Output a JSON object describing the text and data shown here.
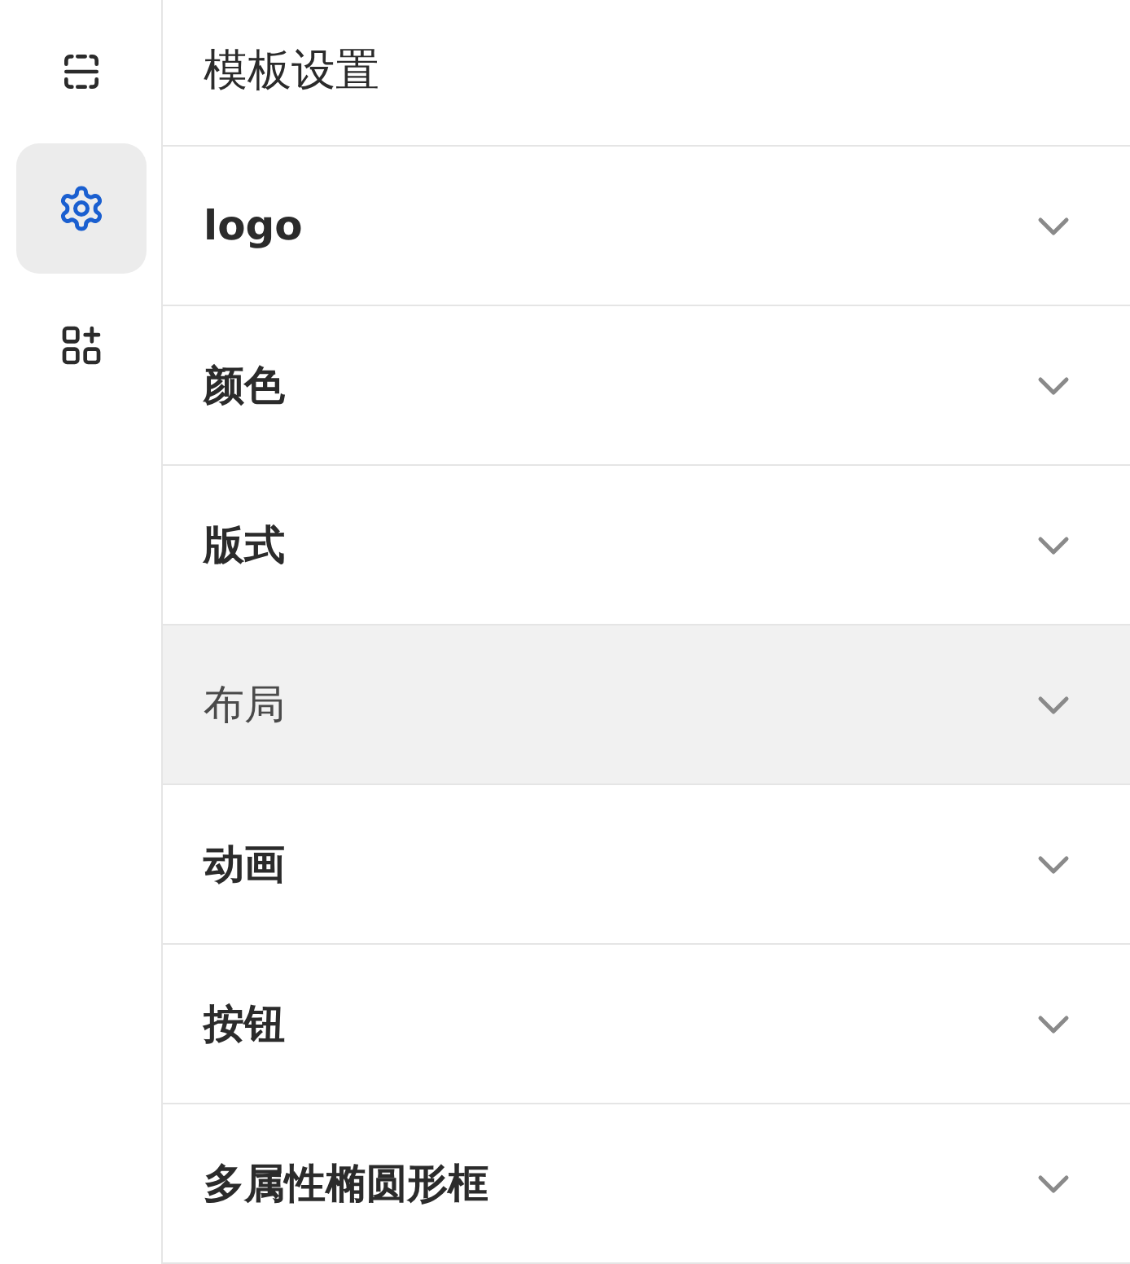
{
  "sidebar": {
    "items": [
      {
        "kind": "frame",
        "selected": false
      },
      {
        "kind": "gear",
        "selected": true
      },
      {
        "kind": "apps",
        "selected": false
      }
    ]
  },
  "panel": {
    "title": "模板设置",
    "sections": [
      {
        "label": "logo",
        "highlighted": false,
        "expanded": false
      },
      {
        "label": "颜色",
        "highlighted": false,
        "expanded": false
      },
      {
        "label": "版式",
        "highlighted": false,
        "expanded": false
      },
      {
        "label": "布局",
        "highlighted": true,
        "expanded": false
      },
      {
        "label": "动画",
        "highlighted": false,
        "expanded": false
      },
      {
        "label": "按钮",
        "highlighted": false,
        "expanded": false
      },
      {
        "label": "多属性椭圆形框",
        "highlighted": false,
        "expanded": false
      }
    ]
  }
}
